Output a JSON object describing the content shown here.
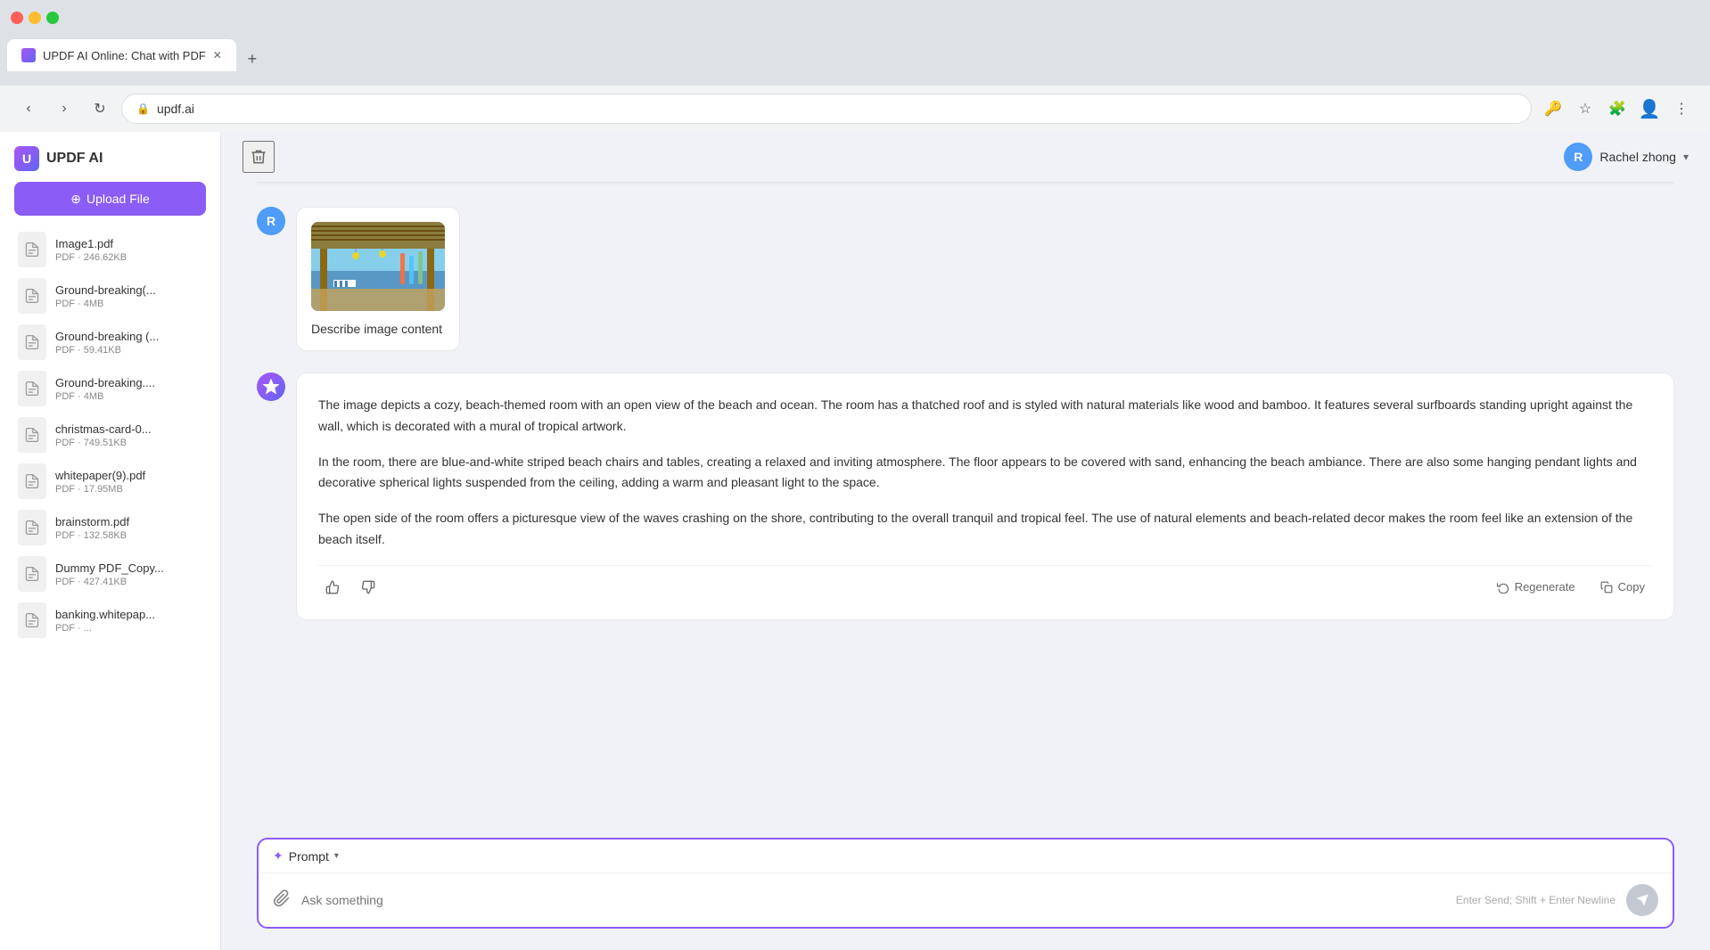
{
  "browser": {
    "tab_title": "UPDF AI Online: Chat with PDF",
    "url": "updf.ai",
    "new_tab_label": "+",
    "nav_back": "‹",
    "nav_forward": "›",
    "nav_refresh": "↻"
  },
  "sidebar": {
    "app_name": "UPDF AI",
    "upload_btn": "Upload File",
    "files": [
      {
        "name": "Image1.pdf",
        "meta": "PDF · 246.62KB"
      },
      {
        "name": "Ground-breaking(...",
        "meta": "PDF · 4MB"
      },
      {
        "name": "Ground-breaking (...",
        "meta": "PDF · 59.41KB"
      },
      {
        "name": "Ground-breaking....",
        "meta": "PDF · 4MB"
      },
      {
        "name": "christmas-card-0...",
        "meta": "PDF · 749.51KB"
      },
      {
        "name": "whitepaper(9).pdf",
        "meta": "PDF · 17.95MB"
      },
      {
        "name": "brainstorm.pdf",
        "meta": "PDF · 132.58KB"
      },
      {
        "name": "Dummy PDF_Copy...",
        "meta": "PDF · 427.41KB"
      },
      {
        "name": "banking.whitepap...",
        "meta": "PDF · ..."
      }
    ]
  },
  "header": {
    "user_name": "Rachel zhong",
    "user_initial": "R"
  },
  "user_message": {
    "avatar_initial": "R",
    "describe_label": "Describe image content"
  },
  "ai_response": {
    "paragraph1": "The image depicts a cozy, beach-themed room with an open view of the beach and ocean. The room has a thatched roof and is styled with natural materials like wood and bamboo. It features several surfboards standing upright against the wall, which is decorated with a mural of tropical artwork.",
    "paragraph2": "In the room, there are blue-and-white striped beach chairs and tables, creating a relaxed and inviting atmosphere. The floor appears to be covered with sand, enhancing the beach ambiance. There are also some hanging pendant lights and decorative spherical lights suspended from the ceiling, adding a warm and pleasant light to the space.",
    "paragraph3": "The open side of the room offers a picturesque view of the waves crashing on the shore, contributing to the overall tranquil and tropical feel. The use of natural elements and beach-related decor makes the room feel like an extension of the beach itself.",
    "regenerate_label": "Regenerate",
    "copy_label": "Copy"
  },
  "input": {
    "prompt_label": "Prompt",
    "placeholder": "Ask something",
    "hint": "Enter Send; Shift + Enter Newline"
  },
  "icons": {
    "trash": "🗑",
    "thumbup": "👍",
    "thumbdown": "👎",
    "regenerate": "↻",
    "copy": "⧉",
    "attach": "📎",
    "sparkle": "✦",
    "upload": "⊕",
    "send": "➤"
  }
}
